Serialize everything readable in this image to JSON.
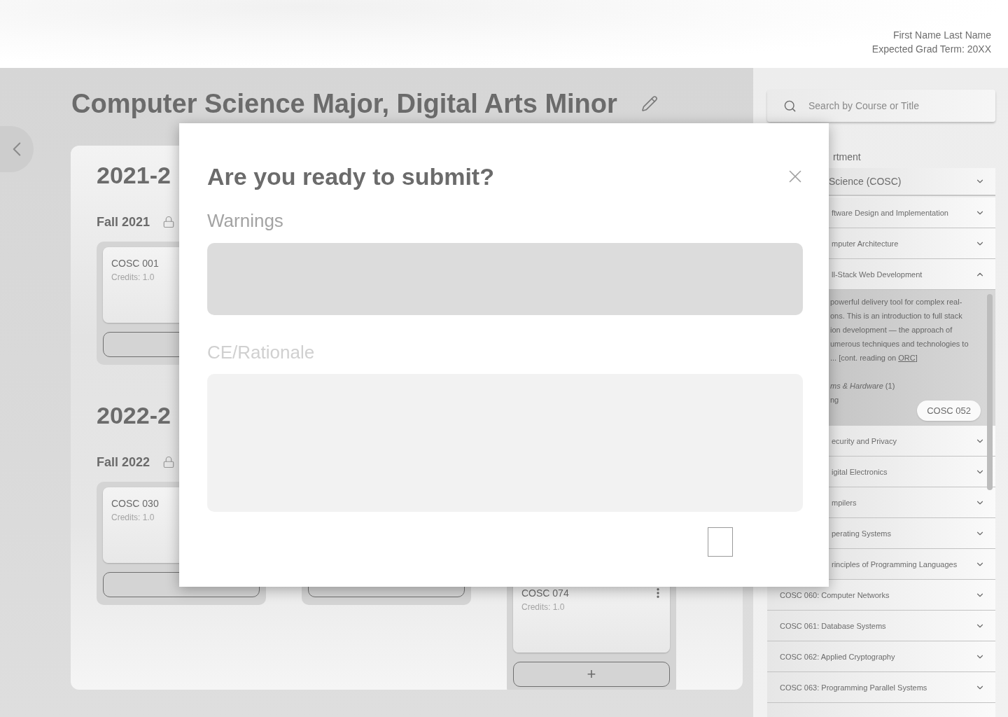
{
  "header": {
    "user_name": "First Name Last Name",
    "grad_term": "Expected Grad Term: 20XX"
  },
  "plan": {
    "title": "Computer Science Major, Digital Arts Minor",
    "years": [
      {
        "label": "2021-2",
        "semesters": [
          {
            "kind": "full",
            "name": "Fall 2021",
            "locked": true,
            "courses": [
              {
                "code": "COSC 001",
                "credits": "Credits: 1.0"
              }
            ]
          }
        ]
      },
      {
        "label": "2022-2",
        "semesters": [
          {
            "kind": "full",
            "name": "Fall 2022",
            "locked": true,
            "courses": [
              {
                "code": "COSC 030",
                "credits": "Credits: 1.0"
              }
            ]
          },
          {
            "kind": "hidden_top"
          },
          {
            "kind": "hidden_top",
            "courses": [
              {
                "code": "COSC 074",
                "credits": "Credits: 1.0",
                "menu": true
              }
            ],
            "add_label": "+"
          }
        ]
      }
    ]
  },
  "sidebar": {
    "search": {
      "placeholder": "Search by Course or Title"
    },
    "department_label": "rtment",
    "department_select": {
      "value": "Science (COSC)"
    },
    "courses": [
      {
        "kind": "partial",
        "title": "ftware Design and Implementation",
        "expanded": false
      },
      {
        "kind": "partial",
        "title": "mputer Architecture",
        "expanded": false
      },
      {
        "kind": "partial",
        "title": "ll-Stack Web Development",
        "expanded": true,
        "details": {
          "lines": [
            "powerful delivery tool for complex real-",
            "ons. This is an introduction to full stack",
            "ion development — the approach of",
            "umerous techniques and technologies to"
          ],
          "more": {
            "text": "... [cont. reading on",
            "link": "ORC",
            "close": "]"
          },
          "category": "*ms & Hardware* (1)",
          "term": "ng",
          "prerequisite": "COSC 052"
        }
      },
      {
        "kind": "partial",
        "title": "ecurity and Privacy",
        "expanded": false
      },
      {
        "kind": "partial",
        "title": "igital Electronics",
        "expanded": false
      },
      {
        "kind": "partial",
        "title": "mpilers",
        "expanded": false
      },
      {
        "kind": "partial",
        "title": "perating Systems",
        "expanded": false
      },
      {
        "kind": "partial",
        "title": "rinciples of Programming Languages",
        "expanded": false
      },
      {
        "kind": "full",
        "title": "COSC 060: Computer Networks",
        "expanded": false
      },
      {
        "kind": "full",
        "title": "COSC 061: Database Systems",
        "expanded": false
      },
      {
        "kind": "full",
        "title": "COSC 062: Applied Cryptography",
        "expanded": false
      },
      {
        "kind": "full",
        "title": "COSC 063: Programming Parallel Systems",
        "expanded": false
      },
      {
        "kind": "cut"
      }
    ]
  },
  "modal": {
    "title": "Are you ready to submit?",
    "warnings_label": "Warnings",
    "rationale_label": "CE/Rationale"
  }
}
